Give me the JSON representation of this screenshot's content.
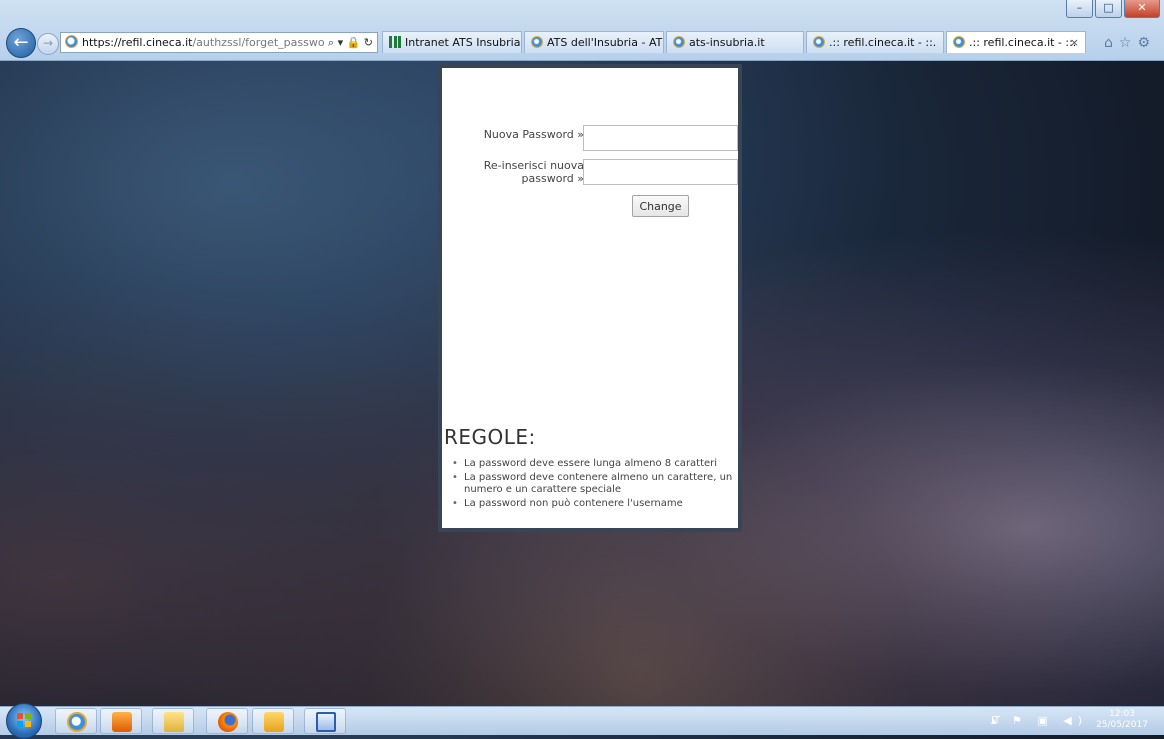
{
  "browser": {
    "address": {
      "host": "https://refil.cineca.it",
      "path": "/authzssl/forget_password/?CheckS",
      "tools": "⌕ ▾ 🔒 ↻"
    },
    "tabs": [
      {
        "label": "Intranet ATS Insubria",
        "icon": "ats-logo-icon"
      },
      {
        "label": "ATS dell'Insubria - ATS d...",
        "icon": "ie-icon"
      },
      {
        "label": "ats-insubria.it",
        "icon": "ie-icon"
      },
      {
        "label": ".:: refil.cineca.it - ::.",
        "icon": "ie-icon"
      },
      {
        "label": ".:: refil.cineca.it - ::.",
        "icon": "ie-icon",
        "active": true,
        "close": "×"
      }
    ],
    "window_controls": {
      "minimize": "–",
      "maximize": "□",
      "close": "✕"
    },
    "right_icons": "⌂☆⚙"
  },
  "form": {
    "new_password_label": "Nuova Password »",
    "reenter_label_line1": "Re-inserisci nuova",
    "reenter_label_line2": "password »",
    "new_password_value": "",
    "reenter_value": "",
    "change_button": "Change"
  },
  "rules": {
    "title": "REGOLE:",
    "items": [
      "La password deve essere lunga almeno 8 caratteri",
      "La password deve contenere almeno un carattere, un numero e un carattere speciale",
      "La password non può contenere l'username"
    ]
  },
  "taskbar": {
    "language": "IT",
    "tray_icons": "▴ ⚑ ▣ ◀)",
    "time": "12:03",
    "date": "25/05/2017"
  }
}
